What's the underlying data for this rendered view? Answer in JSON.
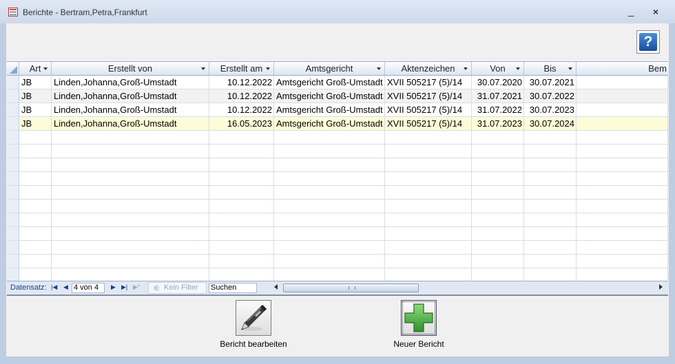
{
  "window": {
    "title": "Berichte - Bertram,Petra,Frankfurt",
    "minimize": "_",
    "close": "×"
  },
  "help": {
    "label": "?"
  },
  "grid": {
    "columns": [
      "Art",
      "Erstellt von",
      "Erstellt am",
      "Amtsgericht",
      "Aktenzeichen",
      "Von",
      "Bis",
      "Bem"
    ],
    "rows": [
      [
        "JB",
        "Linden,Johanna,Groß-Umstadt",
        "10.12.2022",
        "Amtsgericht Groß-Umstadt",
        "XVII 505217 (5)/14",
        "30.07.2020",
        "30.07.2021",
        ""
      ],
      [
        "JB",
        "Linden,Johanna,Groß-Umstadt",
        "10.12.2022",
        "Amtsgericht Groß-Umstadt",
        "XVII 505217 (5)/14",
        "31.07.2021",
        "30.07.2022",
        ""
      ],
      [
        "JB",
        "Linden,Johanna,Groß-Umstadt",
        "10.12.2022",
        "Amtsgericht Groß-Umstadt",
        "XVII 505217 (5)/14",
        "31.07.2022",
        "30.07.2023",
        ""
      ],
      [
        "JB",
        "Linden,Johanna,Groß-Umstadt",
        "16.05.2023",
        "Amtsgericht Groß-Umstadt",
        "XVII 505217 (5)/14",
        "31.07.2023",
        "30.07.2024",
        ""
      ]
    ]
  },
  "navigation": {
    "label": "Datensatz:",
    "position": "4 von 4",
    "filter": "Kein Filter",
    "search": "Suchen"
  },
  "actions": {
    "edit_label": "Bericht bearbeiten",
    "new_label": "Neuer Bericht"
  },
  "icons": {
    "edit": "pen-icon",
    "new": "plus-icon"
  },
  "colors": {
    "current_row": "#fcfcd8",
    "plus_green": "#3aa63a",
    "help_blue": "#1a4f9c"
  }
}
